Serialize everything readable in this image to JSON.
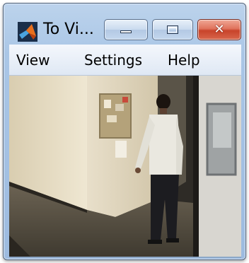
{
  "window": {
    "title": "To Vi...",
    "app_icon": "matlab-logo-icon",
    "controls": {
      "minimize_icon": "minimize-icon",
      "maximize_icon": "maximize-icon",
      "close_icon": "close-icon",
      "close_glyph": "✕"
    }
  },
  "menu": {
    "items": [
      {
        "label": "View"
      },
      {
        "label": "Settings"
      },
      {
        "label": "Help"
      }
    ]
  },
  "video": {
    "description_icon": "video-frame"
  },
  "colors": {
    "titlebar": "#aac6e6",
    "close_button": "#d8664c",
    "menubar": "#eaf0f8"
  }
}
